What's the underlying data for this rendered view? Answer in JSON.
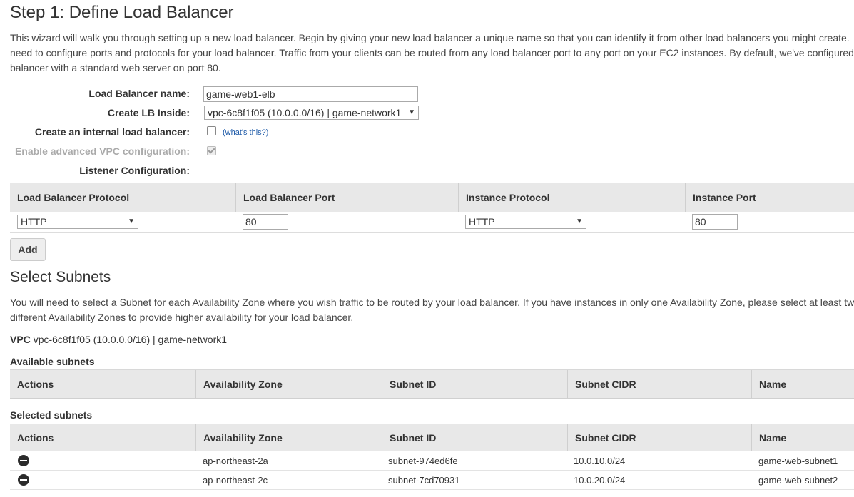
{
  "page": {
    "title": "Step 1: Define Load Balancer",
    "intro_line1": "This wizard will walk you through setting up a new load balancer. Begin by giving your new load balancer a unique name so that you can identify it from other load balancers you might create.",
    "intro_line2": "need to configure ports and protocols for your load balancer. Traffic from your clients can be routed from any load balancer port to any port on your EC2 instances. By default, we've configured",
    "intro_line3": "balancer with a standard web server on port 80."
  },
  "form": {
    "lb_name_label": "Load Balancer name:",
    "lb_name_value": "game-web1-elb",
    "create_inside_label": "Create LB Inside:",
    "create_inside_value": "vpc-6c8f1f05 (10.0.0.0/16) | game-network1",
    "internal_label": "Create an internal load balancer:",
    "internal_checked": false,
    "whats_this": "(what's this?)",
    "advanced_vpc_label": "Enable advanced VPC configuration:",
    "advanced_vpc_checked": true,
    "listener_label": "Listener Configuration:"
  },
  "listeners": {
    "headers": [
      "Load Balancer Protocol",
      "Load Balancer Port",
      "Instance Protocol",
      "Instance Port"
    ],
    "rows": [
      {
        "lb_protocol": "HTTP",
        "lb_port": "80",
        "instance_protocol": "HTTP",
        "instance_port": "80"
      }
    ],
    "add_label": "Add"
  },
  "subnets": {
    "title": "Select Subnets",
    "desc_line1": "You will need to select a Subnet for each Availability Zone where you wish traffic to be routed by your load balancer. If you have instances in only one Availability Zone, please select at least two Subnets in",
    "desc_line2": "different Availability Zones to provide higher availability for your load balancer.",
    "vpc_label": "VPC",
    "vpc_value": "vpc-6c8f1f05 (10.0.0.0/16) | game-network1",
    "available_label": "Available subnets",
    "selected_label": "Selected subnets",
    "headers": [
      "Actions",
      "Availability Zone",
      "Subnet ID",
      "Subnet CIDR",
      "Name"
    ],
    "selected_rows": [
      {
        "az": "ap-northeast-2a",
        "subnet_id": "subnet-974ed6fe",
        "cidr": "10.0.10.0/24",
        "name": "game-web-subnet1"
      },
      {
        "az": "ap-northeast-2c",
        "subnet_id": "subnet-7cd70931",
        "cidr": "10.0.20.0/24",
        "name": "game-web-subnet2"
      }
    ]
  }
}
